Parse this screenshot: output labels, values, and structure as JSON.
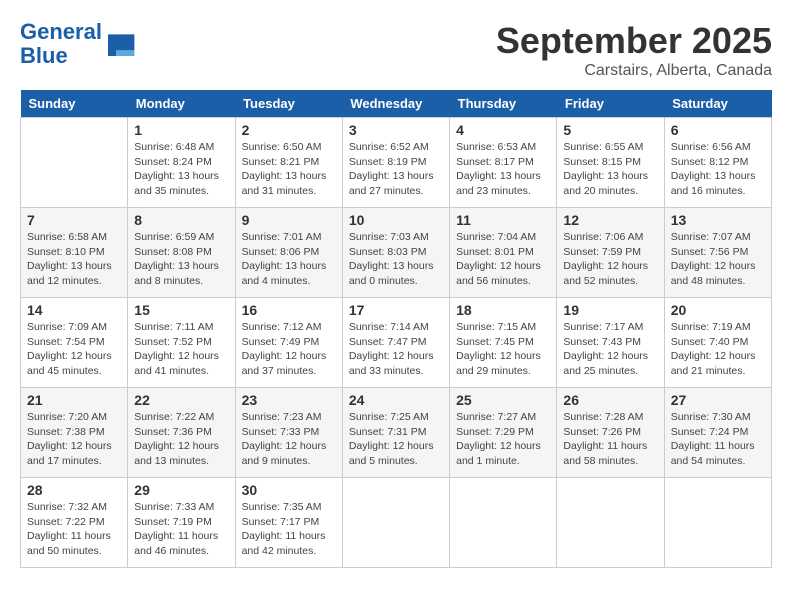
{
  "header": {
    "logo_line1": "General",
    "logo_line2": "Blue",
    "month": "September 2025",
    "location": "Carstairs, Alberta, Canada"
  },
  "days_of_week": [
    "Sunday",
    "Monday",
    "Tuesday",
    "Wednesday",
    "Thursday",
    "Friday",
    "Saturday"
  ],
  "weeks": [
    [
      {
        "day": "",
        "info": ""
      },
      {
        "day": "1",
        "info": "Sunrise: 6:48 AM\nSunset: 8:24 PM\nDaylight: 13 hours\nand 35 minutes."
      },
      {
        "day": "2",
        "info": "Sunrise: 6:50 AM\nSunset: 8:21 PM\nDaylight: 13 hours\nand 31 minutes."
      },
      {
        "day": "3",
        "info": "Sunrise: 6:52 AM\nSunset: 8:19 PM\nDaylight: 13 hours\nand 27 minutes."
      },
      {
        "day": "4",
        "info": "Sunrise: 6:53 AM\nSunset: 8:17 PM\nDaylight: 13 hours\nand 23 minutes."
      },
      {
        "day": "5",
        "info": "Sunrise: 6:55 AM\nSunset: 8:15 PM\nDaylight: 13 hours\nand 20 minutes."
      },
      {
        "day": "6",
        "info": "Sunrise: 6:56 AM\nSunset: 8:12 PM\nDaylight: 13 hours\nand 16 minutes."
      }
    ],
    [
      {
        "day": "7",
        "info": "Sunrise: 6:58 AM\nSunset: 8:10 PM\nDaylight: 13 hours\nand 12 minutes."
      },
      {
        "day": "8",
        "info": "Sunrise: 6:59 AM\nSunset: 8:08 PM\nDaylight: 13 hours\nand 8 minutes."
      },
      {
        "day": "9",
        "info": "Sunrise: 7:01 AM\nSunset: 8:06 PM\nDaylight: 13 hours\nand 4 minutes."
      },
      {
        "day": "10",
        "info": "Sunrise: 7:03 AM\nSunset: 8:03 PM\nDaylight: 13 hours\nand 0 minutes."
      },
      {
        "day": "11",
        "info": "Sunrise: 7:04 AM\nSunset: 8:01 PM\nDaylight: 12 hours\nand 56 minutes."
      },
      {
        "day": "12",
        "info": "Sunrise: 7:06 AM\nSunset: 7:59 PM\nDaylight: 12 hours\nand 52 minutes."
      },
      {
        "day": "13",
        "info": "Sunrise: 7:07 AM\nSunset: 7:56 PM\nDaylight: 12 hours\nand 48 minutes."
      }
    ],
    [
      {
        "day": "14",
        "info": "Sunrise: 7:09 AM\nSunset: 7:54 PM\nDaylight: 12 hours\nand 45 minutes."
      },
      {
        "day": "15",
        "info": "Sunrise: 7:11 AM\nSunset: 7:52 PM\nDaylight: 12 hours\nand 41 minutes."
      },
      {
        "day": "16",
        "info": "Sunrise: 7:12 AM\nSunset: 7:49 PM\nDaylight: 12 hours\nand 37 minutes."
      },
      {
        "day": "17",
        "info": "Sunrise: 7:14 AM\nSunset: 7:47 PM\nDaylight: 12 hours\nand 33 minutes."
      },
      {
        "day": "18",
        "info": "Sunrise: 7:15 AM\nSunset: 7:45 PM\nDaylight: 12 hours\nand 29 minutes."
      },
      {
        "day": "19",
        "info": "Sunrise: 7:17 AM\nSunset: 7:43 PM\nDaylight: 12 hours\nand 25 minutes."
      },
      {
        "day": "20",
        "info": "Sunrise: 7:19 AM\nSunset: 7:40 PM\nDaylight: 12 hours\nand 21 minutes."
      }
    ],
    [
      {
        "day": "21",
        "info": "Sunrise: 7:20 AM\nSunset: 7:38 PM\nDaylight: 12 hours\nand 17 minutes."
      },
      {
        "day": "22",
        "info": "Sunrise: 7:22 AM\nSunset: 7:36 PM\nDaylight: 12 hours\nand 13 minutes."
      },
      {
        "day": "23",
        "info": "Sunrise: 7:23 AM\nSunset: 7:33 PM\nDaylight: 12 hours\nand 9 minutes."
      },
      {
        "day": "24",
        "info": "Sunrise: 7:25 AM\nSunset: 7:31 PM\nDaylight: 12 hours\nand 5 minutes."
      },
      {
        "day": "25",
        "info": "Sunrise: 7:27 AM\nSunset: 7:29 PM\nDaylight: 12 hours\nand 1 minute."
      },
      {
        "day": "26",
        "info": "Sunrise: 7:28 AM\nSunset: 7:26 PM\nDaylight: 11 hours\nand 58 minutes."
      },
      {
        "day": "27",
        "info": "Sunrise: 7:30 AM\nSunset: 7:24 PM\nDaylight: 11 hours\nand 54 minutes."
      }
    ],
    [
      {
        "day": "28",
        "info": "Sunrise: 7:32 AM\nSunset: 7:22 PM\nDaylight: 11 hours\nand 50 minutes."
      },
      {
        "day": "29",
        "info": "Sunrise: 7:33 AM\nSunset: 7:19 PM\nDaylight: 11 hours\nand 46 minutes."
      },
      {
        "day": "30",
        "info": "Sunrise: 7:35 AM\nSunset: 7:17 PM\nDaylight: 11 hours\nand 42 minutes."
      },
      {
        "day": "",
        "info": ""
      },
      {
        "day": "",
        "info": ""
      },
      {
        "day": "",
        "info": ""
      },
      {
        "day": "",
        "info": ""
      }
    ]
  ]
}
